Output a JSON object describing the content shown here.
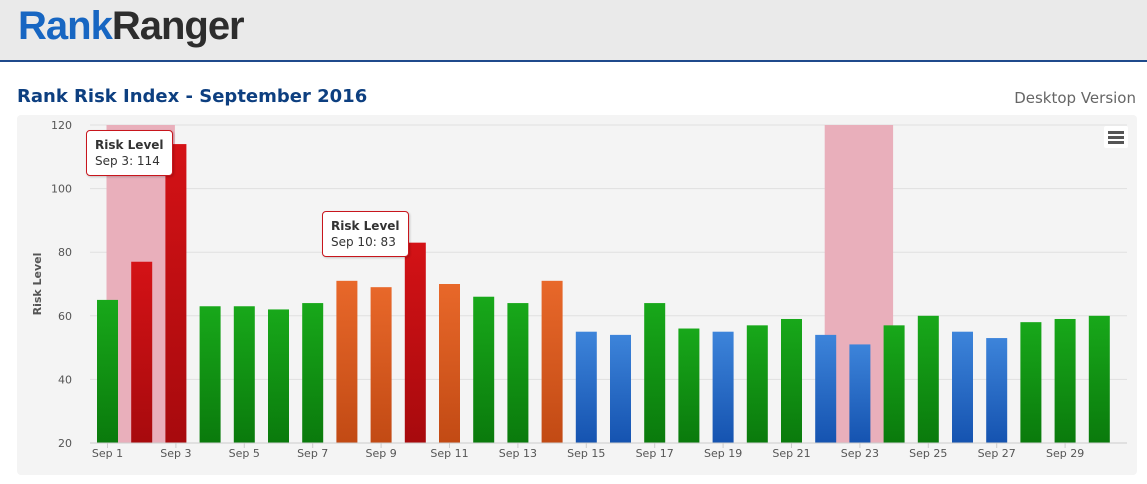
{
  "header": {
    "logo_part1": "Rank",
    "logo_part2": "Ranger"
  },
  "page": {
    "title": "Rank Risk Index - September 2016",
    "version": "Desktop Version"
  },
  "colors": {
    "green": "#18a81a",
    "red": "#d41216",
    "orange": "#e8682a",
    "blue": "#3d84da",
    "band": "#e9afbb"
  },
  "tooltips": [
    {
      "title": "Risk Level",
      "text": "Sep 3: 114"
    },
    {
      "title": "Risk Level",
      "text": "Sep 10: 83"
    }
  ],
  "chart_data": {
    "type": "bar",
    "title": "Rank Risk Index - September 2016",
    "xlabel": "",
    "ylabel": "Risk Level",
    "ylim": [
      20,
      120
    ],
    "yticks": [
      20,
      40,
      60,
      80,
      100,
      120
    ],
    "grid": true,
    "categories": [
      "Sep 1",
      "Sep 2",
      "Sep 3",
      "Sep 4",
      "Sep 5",
      "Sep 6",
      "Sep 7",
      "Sep 8",
      "Sep 9",
      "Sep 10",
      "Sep 11",
      "Sep 12",
      "Sep 13",
      "Sep 14",
      "Sep 15",
      "Sep 16",
      "Sep 17",
      "Sep 18",
      "Sep 19",
      "Sep 20",
      "Sep 21",
      "Sep 22",
      "Sep 23",
      "Sep 24",
      "Sep 25",
      "Sep 26",
      "Sep 27",
      "Sep 28",
      "Sep 29",
      "Sep 30"
    ],
    "values": [
      65,
      77,
      114,
      63,
      63,
      62,
      64,
      71,
      69,
      83,
      70,
      66,
      64,
      71,
      55,
      54,
      64,
      56,
      55,
      57,
      59,
      54,
      51,
      57,
      60,
      55,
      53,
      58,
      59,
      60
    ],
    "levels": [
      "green",
      "red",
      "red",
      "green",
      "green",
      "green",
      "green",
      "orange",
      "orange",
      "red",
      "orange",
      "green",
      "green",
      "orange",
      "blue",
      "blue",
      "green",
      "green",
      "blue",
      "green",
      "green",
      "blue",
      "blue",
      "green",
      "green",
      "blue",
      "blue",
      "green",
      "green",
      "green"
    ],
    "xtick_labels": [
      "Sep 1",
      "Sep 3",
      "Sep 5",
      "Sep 7",
      "Sep 9",
      "Sep 11",
      "Sep 13",
      "Sep 15",
      "Sep 17",
      "Sep 19",
      "Sep 21",
      "Sep 23",
      "Sep 25",
      "Sep 27",
      "Sep 29"
    ],
    "highlight_bands": [
      {
        "from": "Sep 1",
        "to": "Sep 3"
      },
      {
        "from": "Sep 22",
        "to": "Sep 24"
      }
    ]
  }
}
